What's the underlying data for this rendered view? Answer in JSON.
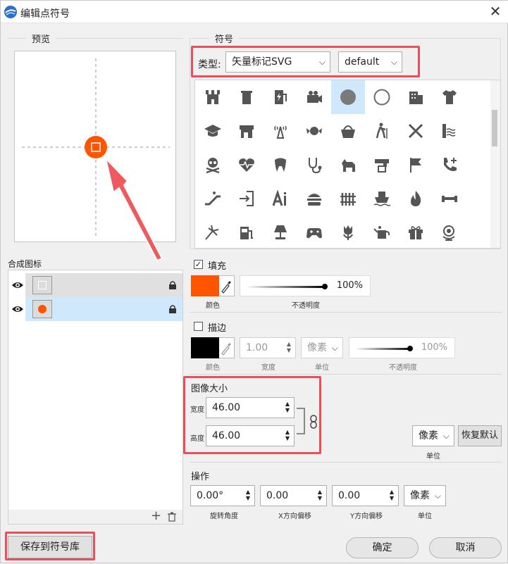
{
  "window": {
    "title": "编辑点符号",
    "close_glyph": "✕"
  },
  "preview": {
    "group_title": "预览",
    "symbol_color": "#ff5500"
  },
  "symbol": {
    "group_title": "符号",
    "type_label": "类型:",
    "type_value": "矢量标记SVG",
    "style_value": "default",
    "icons": [
      [
        "castle-icon",
        "trash-bin-icon",
        "charging-station-icon",
        "camera-icon",
        "circle-filled-icon",
        "circle-outline-icon",
        "building-icon",
        "tshirt-icon"
      ],
      [
        "graduation-cap-icon",
        "shop-icon",
        "radio-tower-icon",
        "candy-icon",
        "basket-icon",
        "hiker-icon",
        "cross-icon",
        "waterfall-icon"
      ],
      [
        "skull-icon",
        "heart-rate-icon",
        "tooth-icon",
        "stethoscope-icon",
        "dog-icon",
        "faucet-icon",
        "flag-icon",
        "phone-plus-icon"
      ],
      [
        "escalator-icon",
        "sign-in-icon",
        "ai-icon",
        "hamburger-icon",
        "fence-icon",
        "ferry-icon",
        "fire-icon",
        "dumbbell-icon"
      ],
      [
        "fireworks-icon",
        "gas-station-icon",
        "lamp-icon",
        "gamepad-icon",
        "tulip-icon",
        "watering-can-icon",
        "gift-icon",
        "globe-icon"
      ]
    ],
    "selected_index": 4
  },
  "layers": {
    "label": "合成图标",
    "items": [
      {
        "name": "layer-square",
        "thumb": "square"
      },
      {
        "name": "layer-circle",
        "thumb": "circle"
      }
    ]
  },
  "fill": {
    "label": "填充",
    "checked": "✓",
    "color": "#ff5500",
    "color_caption": "颜色",
    "opacity_value": "100%",
    "opacity_caption": "不透明度"
  },
  "stroke": {
    "label": "描边",
    "color": "#000000",
    "color_caption": "颜色",
    "width_value": "1.00",
    "width_caption": "宽度",
    "unit_value": "像素",
    "unit_caption": "单位",
    "opacity_value": "100%",
    "opacity_caption": "不透明度"
  },
  "size": {
    "label": "图像大小",
    "width_label": "宽度",
    "width_value": "46.00",
    "height_label": "高度",
    "height_value": "46.00",
    "unit_value": "像素",
    "unit_caption": "单位",
    "reset_label": "恢复默认"
  },
  "ops": {
    "label": "操作",
    "rotation_value": "0.00°",
    "rotation_caption": "旋转角度",
    "xoffset_value": "0.00",
    "xoffset_caption": "X方向偏移",
    "yoffset_value": "0.00",
    "yoffset_caption": "Y方向偏移",
    "unit_value": "像素",
    "unit_caption": "单位"
  },
  "footer": {
    "save_label": "保存到符号库",
    "ok_label": "确定",
    "cancel_label": "取消"
  },
  "colors": {
    "accent_red": "#e8515b",
    "selection": "#cfe8fb",
    "orange": "#ff5500"
  }
}
